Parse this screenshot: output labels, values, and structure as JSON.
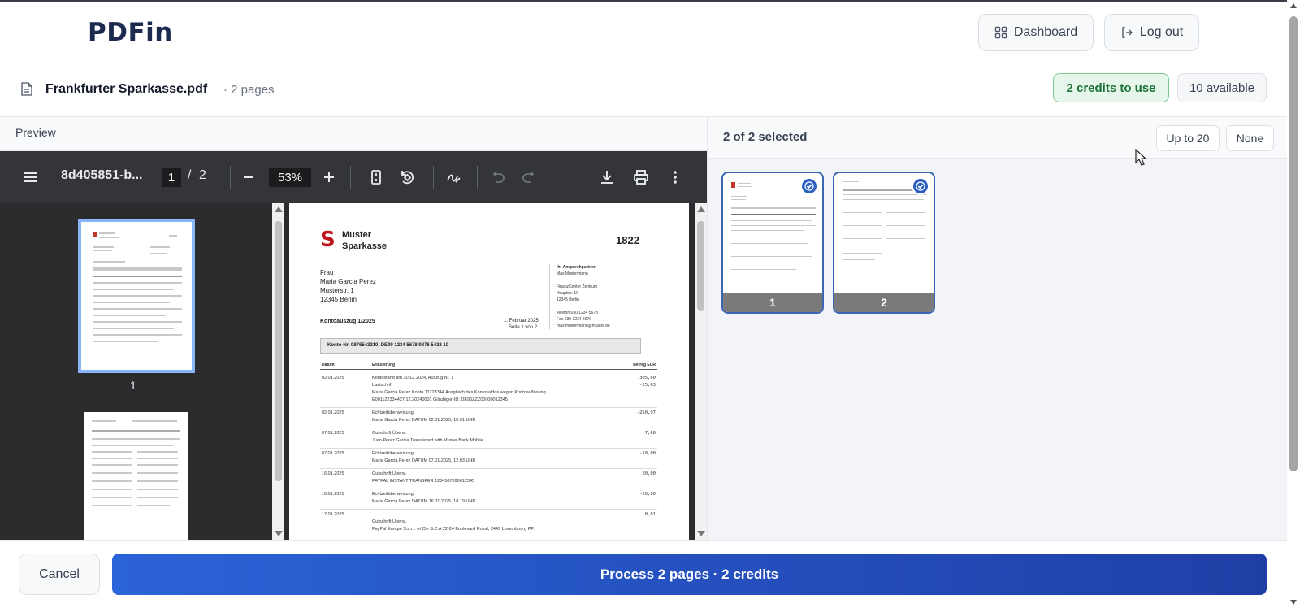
{
  "header": {
    "logo": "PDFin",
    "dashboard_label": "Dashboard",
    "logout_label": "Log out"
  },
  "file": {
    "name": "Frankfurter Sparkasse.pdf",
    "pages": "· 2 pages",
    "credits_to_use": "2 credits to use",
    "available": "10 available"
  },
  "preview": {
    "label": "Preview",
    "viewer": {
      "doc_title": "8d405851-b...",
      "current_page": "1",
      "page_separator": "/",
      "total_pages": "2",
      "zoom": "53%",
      "thumb_label": "1"
    },
    "statement": {
      "bank_logo": "S",
      "bank_name_1": "Muster",
      "bank_name_2": "Sparkasse",
      "bank_code": "1822",
      "addr": [
        "Frau",
        "Maria Garcia Perez",
        "Musterstr. 1",
        "12345 Berlin"
      ],
      "contact": [
        "Ihr Ansprechpartner",
        "Max Mustermann",
        "",
        "FinanzCenter Zentrum",
        "Hauptstr. 10",
        "12345 Berlin",
        "",
        "Telefon 030 1234 5678",
        "Fax 030 1234 5679",
        "max.mustermann@muster.de"
      ],
      "title": "Kontoauszug 1/2025",
      "date": "1. Februar 2025",
      "sheet": "Seite 1 von 2",
      "account": "Konto-Nr. 9876543210, DE99 1234 5678 9876 5432 10",
      "col_date": "Datum",
      "col_desc": "Erläuterung",
      "col_amount": "Betrag EUR",
      "rows": [
        {
          "date": "02.01.2025",
          "desc": "Kontostand am 30.12.2024, Auszug Nr. 1",
          "amount": "305,60"
        },
        {
          "date": "",
          "desc": "Lastschrift",
          "amount": "-25,63"
        },
        {
          "date": "",
          "desc": "Maria Garcia Perez Konto 11223344 Ausgleich des Kontosaldos wegen Kontoauflösung",
          "amount": ""
        },
        {
          "date": "",
          "desc": "E001122334427.12.20240001 Gläubiger-ID: DE96ZZZ00000012345",
          "amount": ""
        },
        {
          "date": "02.01.2025",
          "desc": "Echtzeitüberweisung",
          "amount": "-250,97"
        },
        {
          "date": "",
          "desc": "Maria Garcia Perez DATUM 02.01.2025, 10.51 UHR",
          "amount": ""
        },
        {
          "date": "07.01.2025",
          "desc": "Gutschrift Überw.",
          "amount": "7,66"
        },
        {
          "date": "",
          "desc": "Juan Perez Garcia Transferred with Muster Bank Mobile",
          "amount": ""
        },
        {
          "date": "07.01.2025",
          "desc": "Echtzeitüberweisung",
          "amount": "-10,00"
        },
        {
          "date": "",
          "desc": "Maria Garcia Perez DATUM 07.01.2025, 12.03 UHR",
          "amount": ""
        },
        {
          "date": "16.01.2025",
          "desc": "Gutschrift Überw.",
          "amount": "20,00"
        },
        {
          "date": "",
          "desc": "PAYPAL INSTANT TRANSFER 1234567890012345",
          "amount": ""
        },
        {
          "date": "16.01.2025",
          "desc": "Echtzeitüberweisung",
          "amount": "-20,00"
        },
        {
          "date": "",
          "desc": "Maria Garcia Perez DATUM 16.01.2025, 18.19 UHR",
          "amount": ""
        },
        {
          "date": "17.01.2025",
          "desc": "",
          "amount": "0,01"
        },
        {
          "date": "",
          "desc": "Gutschrift Überw.",
          "amount": ""
        },
        {
          "date": "",
          "desc": "PayPal Europe S.a.r.l. et Cie S.C.A 22-24 Boulevard Royal, 2449 Luxembourg PP.",
          "amount": ""
        }
      ]
    }
  },
  "selection": {
    "count_text": "2 of 2 selected",
    "up_to_label": "Up to 20",
    "none_label": "None",
    "pages": [
      {
        "label": "1"
      },
      {
        "label": "2"
      }
    ]
  },
  "footer": {
    "cancel_label": "Cancel",
    "process_label": "Process 2 pages · 2 credits"
  }
}
